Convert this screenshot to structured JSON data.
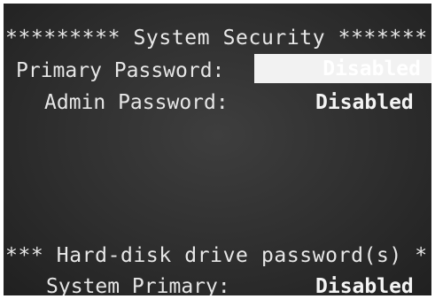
{
  "screen": {
    "section_header": "********* System Security *******",
    "items": [
      {
        "label": "Primary Password:",
        "value": "Disabled"
      },
      {
        "label": "Admin Password:",
        "value": "Disabled"
      }
    ],
    "hdd_header": "*** Hard-disk drive password(s) *",
    "hdd_items": [
      {
        "label": "System Primary:",
        "value": "Disabled"
      }
    ]
  }
}
